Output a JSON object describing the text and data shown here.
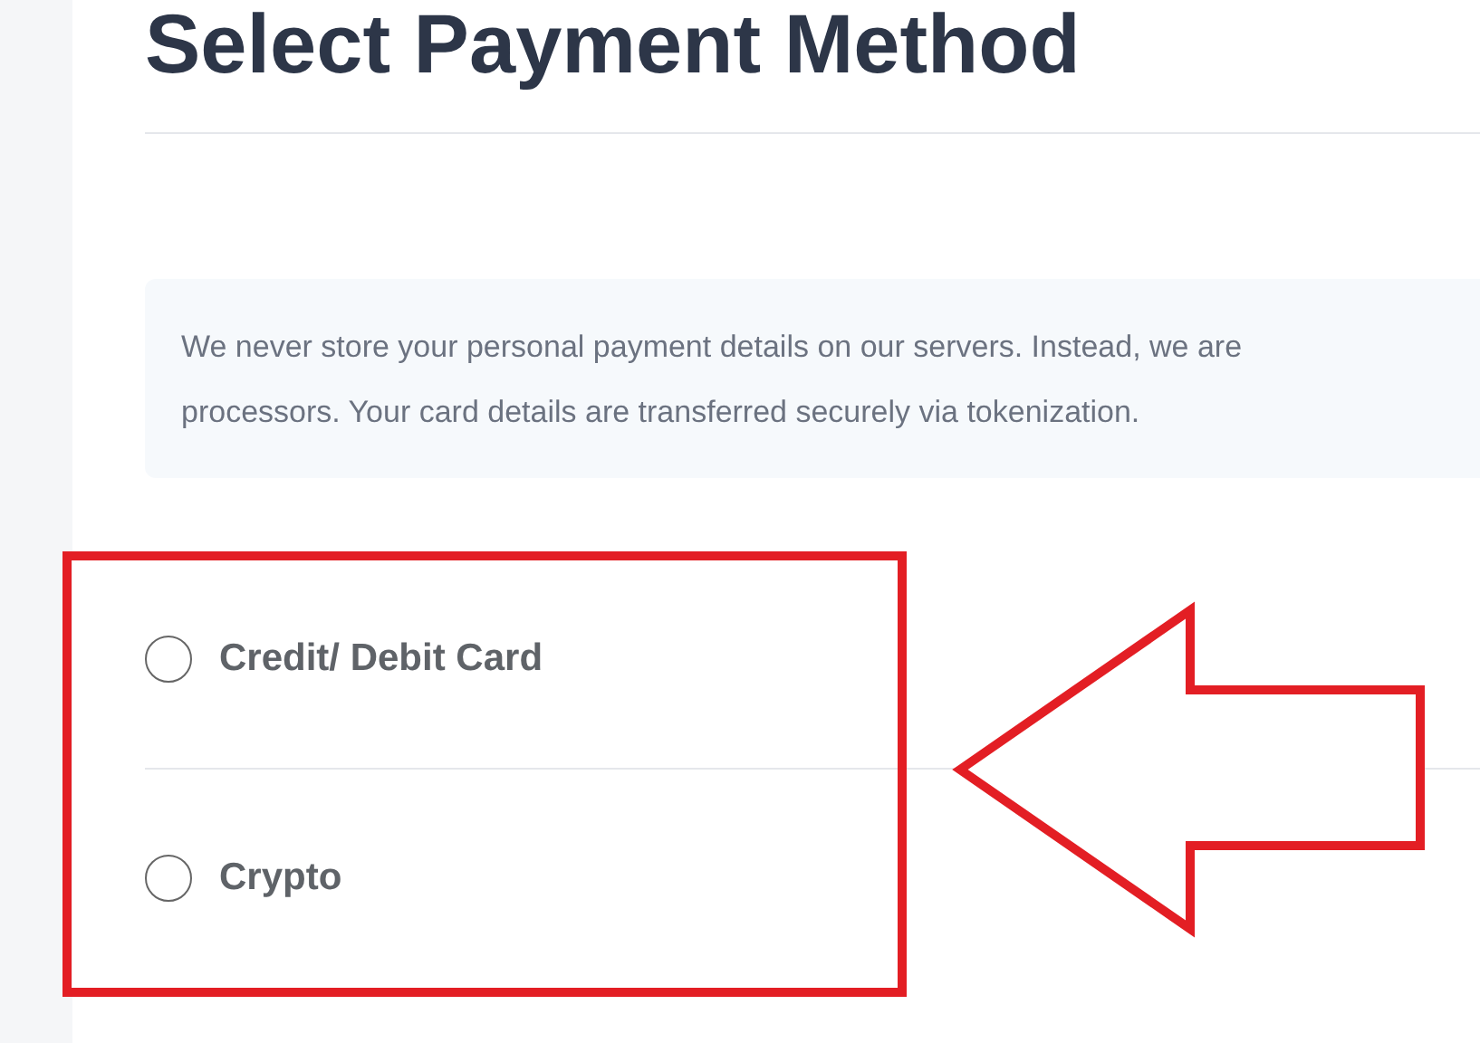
{
  "title": "Select Payment Method",
  "notice": {
    "lines": [
      "We never store your personal payment details on our servers. Instead, we are",
      "processors. Your card details are transferred securely via tokenization."
    ]
  },
  "payment_options": [
    {
      "label": "Credit/ Debit Card",
      "selected": false
    },
    {
      "label": "Crypto",
      "selected": false
    }
  ]
}
